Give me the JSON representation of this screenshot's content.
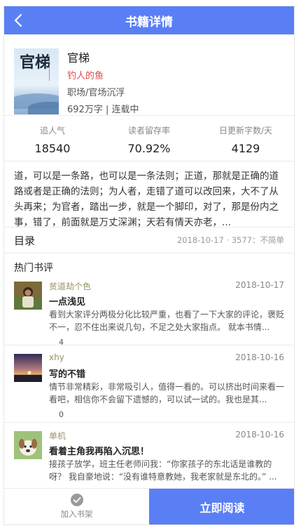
{
  "header": {
    "title": "书籍详情"
  },
  "book": {
    "cover_text": "官梯",
    "name": "官梯",
    "author": "钓人的鱼",
    "category": "职场/官场沉浮",
    "meta": "692万字 | 连载中"
  },
  "stats": [
    {
      "label": "追人气",
      "value": "18540"
    },
    {
      "label": "读者留存率",
      "value": "70.92%"
    },
    {
      "label": "日更新字数/天",
      "value": "4129"
    }
  ],
  "description": "道，可以是一条路，也可以是一条法则；正道，那就是正确的道路或者是正确的法则；为人者，走错了道可以改回来，大不了从头再来；为官者，踏出一步，就是一个脚印，对了，那是份内之事，错了，前面就是万丈深渊；天若有情天亦老，...",
  "toc": {
    "label": "目录",
    "meta": "2018-10-17 · 3577：不简单"
  },
  "hot_reviews_title": "热门书评",
  "reviews": [
    {
      "user": "贫道劫个色",
      "date": "2018-10-17",
      "title": "一点浅见",
      "text": "看到大家评分两极分化比较严重，也看了一下大家的评论，褒贬不一，忍不住出来说几句，不足之处大家指点。 就本书情...",
      "likes": "4"
    },
    {
      "user": "xhy",
      "date": "2018-10-16",
      "title": "写的不错",
      "text": "情节非常精彩，非常吸引人，值得一看的。可以挤出时间来看一看吧，相信你不会留下遗憾的，可以试一试的。我也是其...",
      "likes": "0"
    },
    {
      "user": "单机",
      "date": "2018-10-16",
      "title": "看着主角我再陷入沉思！",
      "text": "接孩子放学，班主任老师问我：“你家孩子的东北话是谁教的呀？ 我自豪地说：“没有谁特意教她，我老家就是东北的。” ...",
      "likes": ""
    }
  ],
  "bottom": {
    "shelf_label": "加入书架",
    "read_label": "立即阅读"
  },
  "colors": {
    "accent": "#5a7ff5",
    "author": "#e04b4b",
    "username": "#9a9367"
  }
}
